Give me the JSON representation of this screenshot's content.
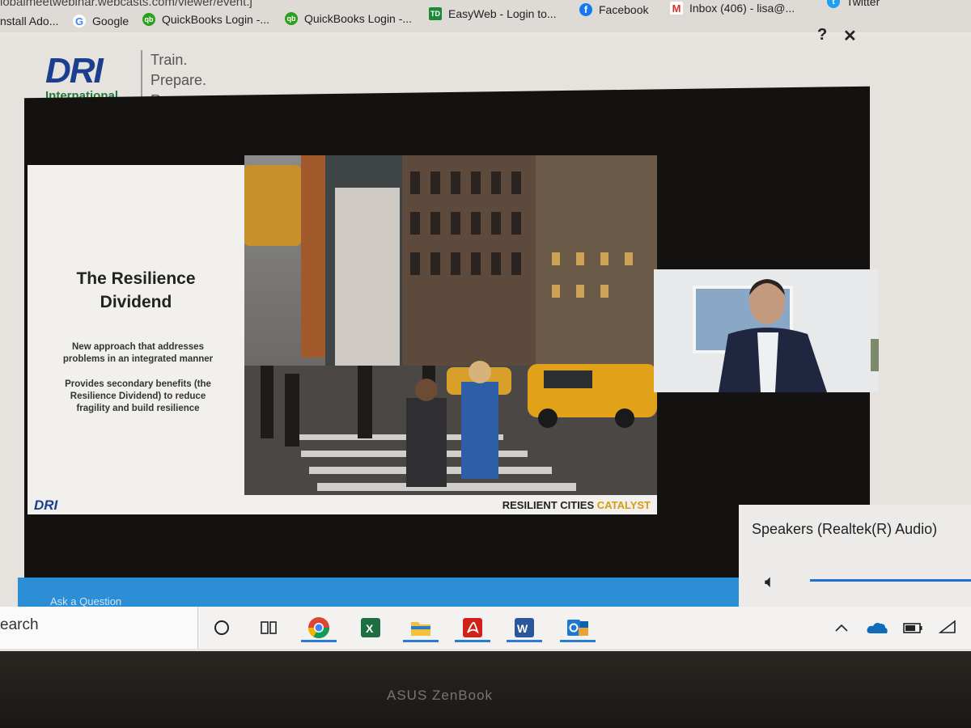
{
  "browser": {
    "url_fragment": "lobalmeetwebinar.webcasts.com/viewer/event.j",
    "bookmarks": [
      {
        "label": "nstall Ado...",
        "icon": "adobe-icon"
      },
      {
        "label": "Google",
        "icon": "google-icon"
      },
      {
        "label": "QuickBooks Login -...",
        "icon": "quickbooks-icon"
      },
      {
        "label": "QuickBooks Login -...",
        "icon": "quickbooks-icon"
      },
      {
        "label": "EasyWeb - Login to...",
        "icon": "td-bank-icon"
      },
      {
        "label": "Facebook",
        "icon": "facebook-icon"
      },
      {
        "label": "Inbox (406) - lisa@...",
        "icon": "gmail-icon"
      },
      {
        "label": "Twitter",
        "icon": "twitter-icon"
      }
    ]
  },
  "header": {
    "help": "?",
    "close": "✕",
    "logo_text": "DRI",
    "logo_sub": "International",
    "tagline": [
      "Train.",
      "Prepare.",
      "Recover."
    ]
  },
  "slide": {
    "title_line1": "The Resilience",
    "title_line2": "Dividend",
    "bullet1_line1": "New approach that addresses",
    "bullet1_line2": "problems in an integrated manner",
    "bullet2_line1": "Provides secondary benefits (the",
    "bullet2_line2": "Resilience Dividend) to reduce",
    "bullet2_line3": "fragility and build resilience",
    "footer_logo": "DRI",
    "footer_brand_a": "RESILIENT CITIES",
    "footer_brand_b": "CATALYST"
  },
  "bottom_bar": {
    "label": "Ask a Question"
  },
  "volume": {
    "device": "Speakers (Realtek(R) Audio)",
    "icon": "speaker-icon",
    "level": 1.0
  },
  "taskbar": {
    "search": "earch",
    "apps": [
      "cortana-icon",
      "task-view-icon",
      "chrome-icon",
      "excel-icon",
      "file-explorer-icon",
      "acrobat-icon",
      "word-icon",
      "outlook-icon"
    ],
    "tray": [
      "chevron-up-icon",
      "onedrive-icon",
      "battery-icon",
      "wifi-icon"
    ]
  },
  "laptop": {
    "brand": "ASUS ZenBook"
  },
  "colors": {
    "dri_blue": "#1b3f8f",
    "dri_green": "#1f7a37",
    "accent_blue": "#2c8fd6",
    "catalyst_gold": "#d79b12"
  }
}
